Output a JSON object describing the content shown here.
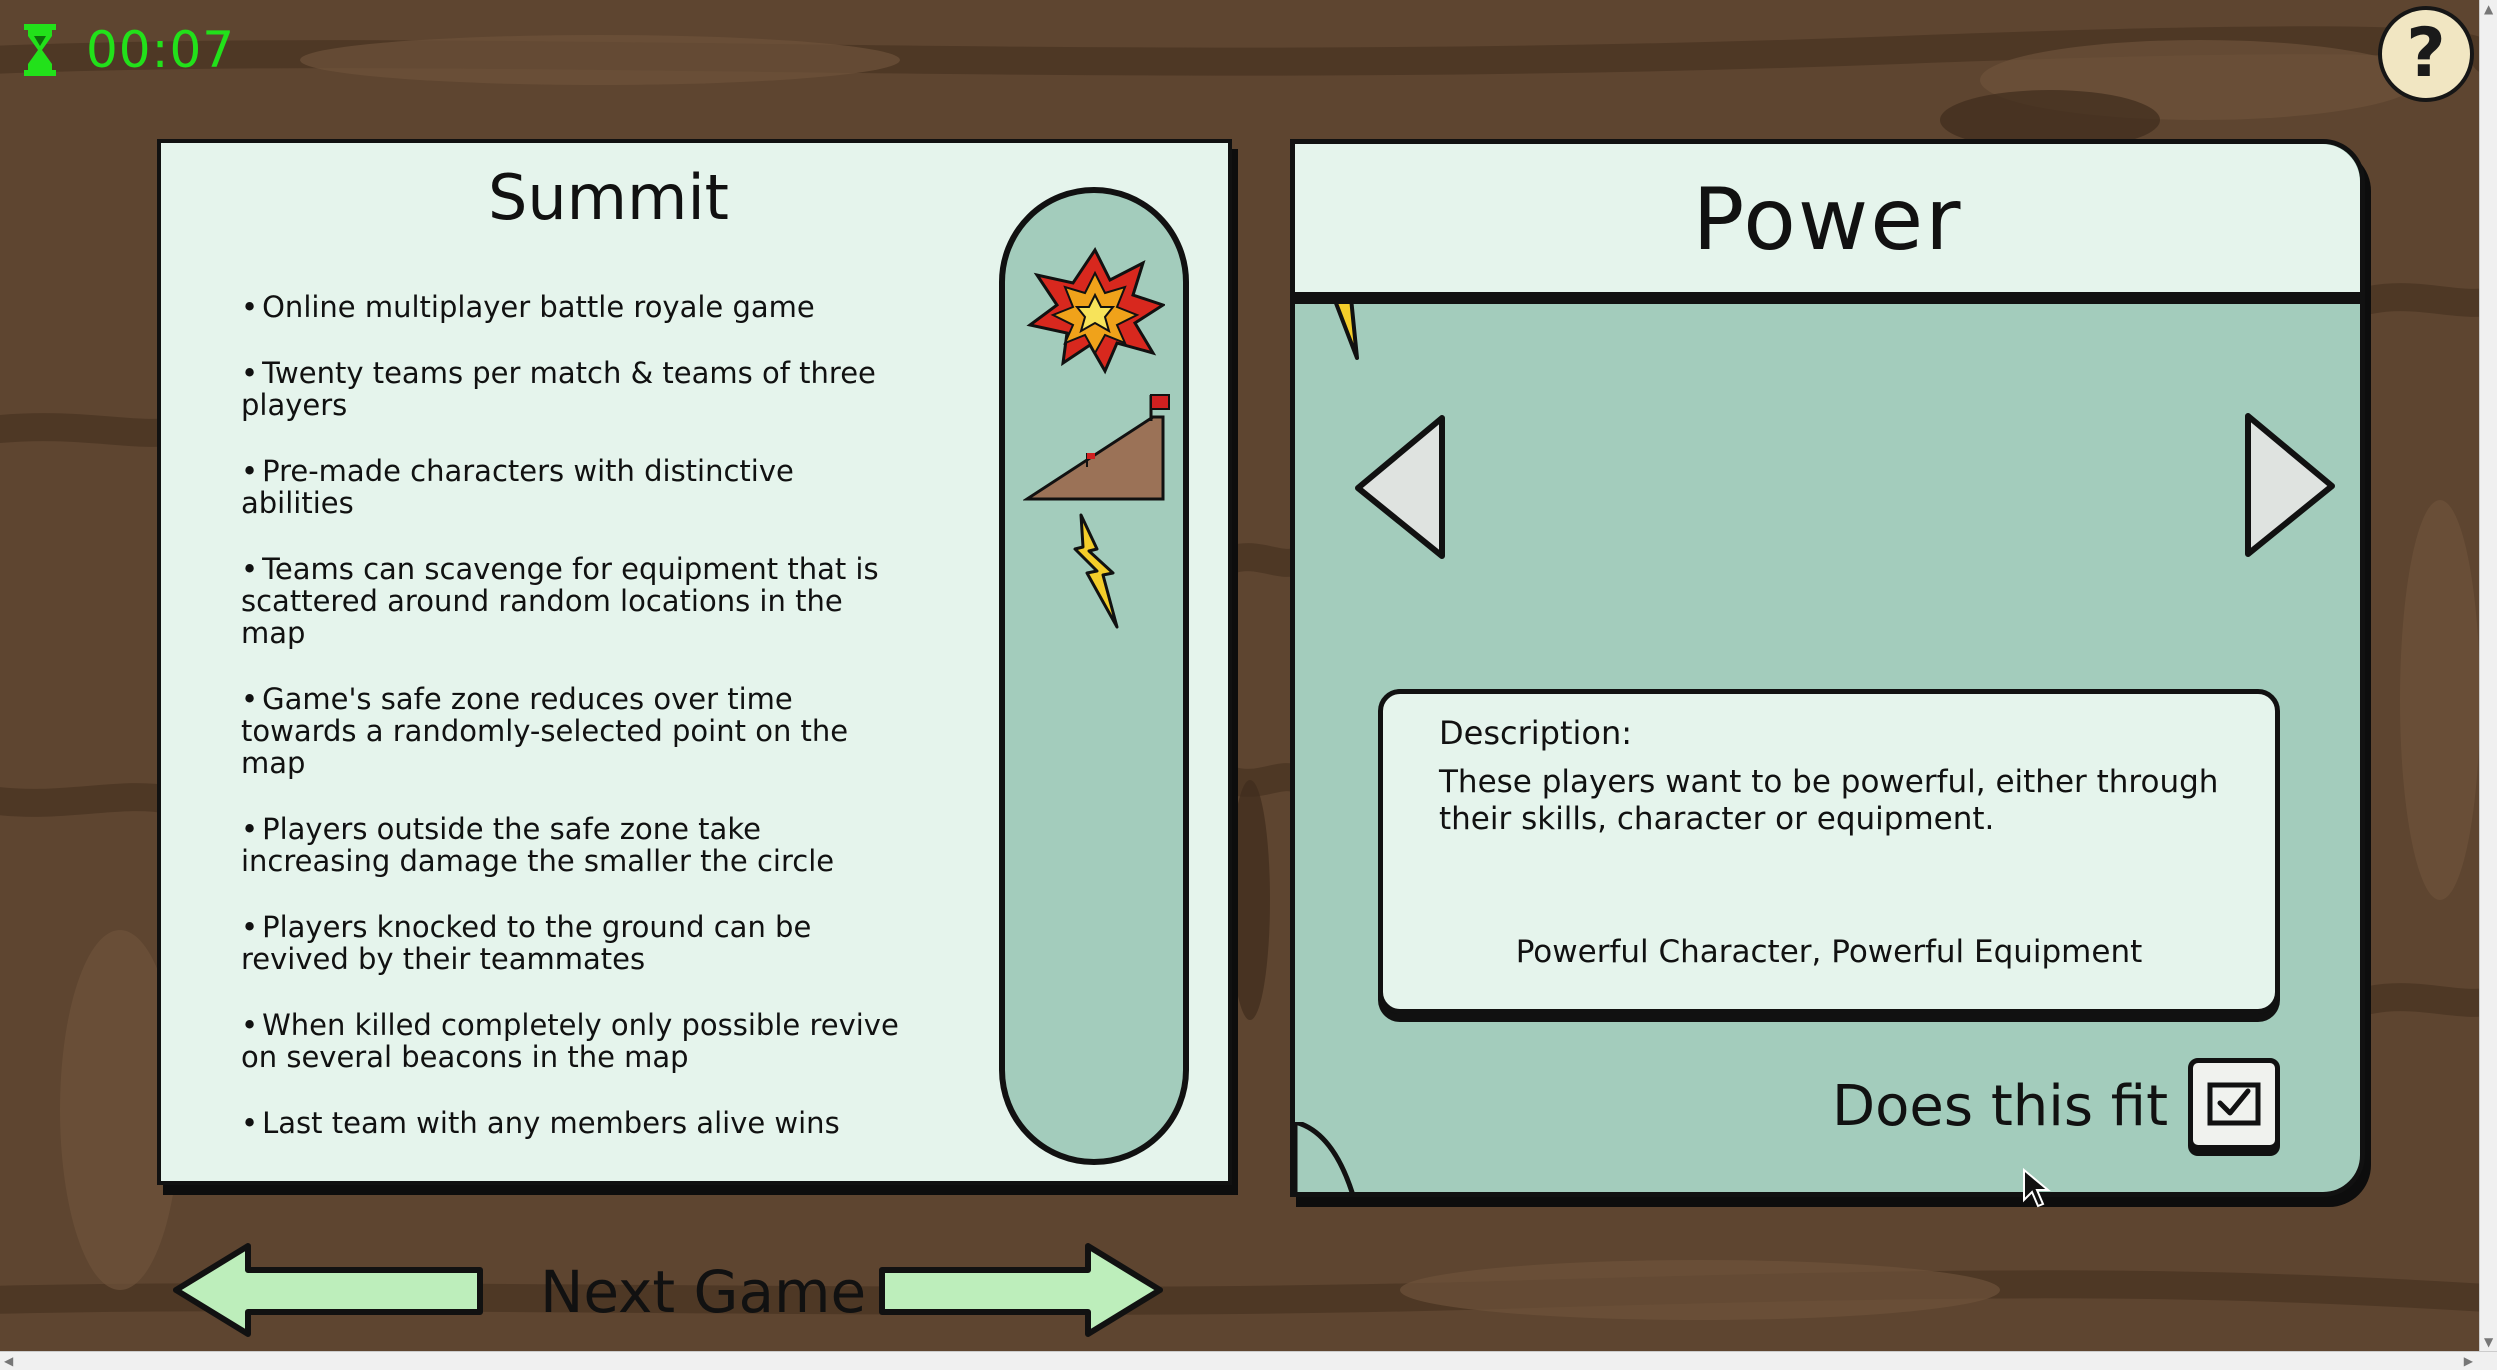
{
  "timer": {
    "value": "00:07",
    "icon": "hourglass-icon",
    "color": "#22e11a"
  },
  "help": {
    "label": "?"
  },
  "game": {
    "title": "Summit",
    "bullets": [
      "Online multiplayer battle royale game",
      "Twenty teams per match & teams of three players",
      "Pre-made characters with distinctive abilities",
      "Teams can scavenge for equipment that is scattered around random locations in the map",
      "Game's safe zone reduces over time towards a randomly-selected point on the map",
      "Players outside the safe zone take increasing damage the smaller the circle",
      "Players knocked to the ground can be revived by their teammates",
      "When killed completely only possible revive on several beacons in the map",
      "Last team with any members alive wins"
    ],
    "icons": [
      "explosion-icon",
      "summit-flag-icon",
      "lightning-icon"
    ]
  },
  "motivation": {
    "title": "Power",
    "icon": "lightning-icon",
    "description_label": "Description:",
    "description": "These players want to be powerful, either through their skills, character or equipment.",
    "tags": "Powerful Character, Powerful Equipment",
    "fit_label": "Does this fit",
    "fit_checked": true
  },
  "footer": {
    "next_game_label": "Next Game"
  },
  "colors": {
    "card_light": "#e5f4ec",
    "card_mint": "#a3ccbc",
    "arrow_green": "#bdeebb",
    "background_wood": "#5e4530"
  }
}
